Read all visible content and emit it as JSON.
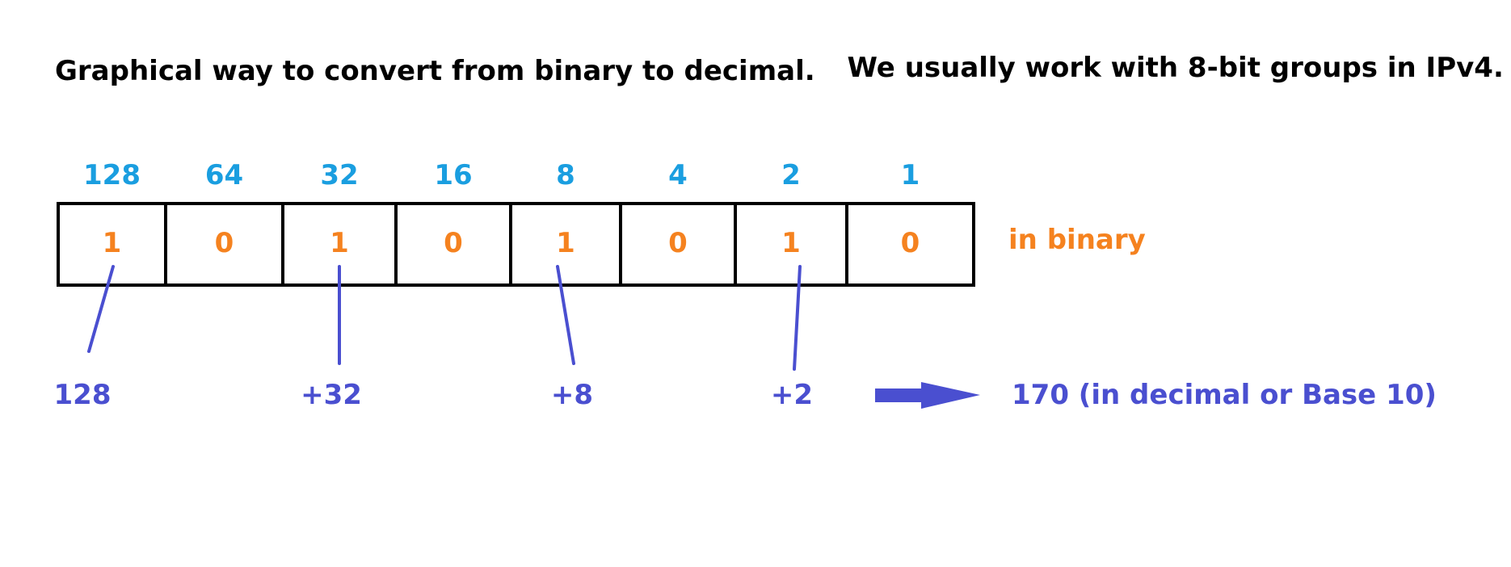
{
  "heading": {
    "part1": "Graphical way to convert from binary to decimal.",
    "part2": "We usually work with 8-bit groups in IPv4."
  },
  "weights": [
    "128",
    "64",
    "32",
    "16",
    "8",
    "4",
    "2",
    "1"
  ],
  "bits": [
    "1",
    "0",
    "1",
    "0",
    "1",
    "0",
    "1",
    "0"
  ],
  "binary_label": "in binary",
  "terms": [
    {
      "bit_index": 0,
      "text": "128"
    },
    {
      "bit_index": 2,
      "text": "+32"
    },
    {
      "bit_index": 4,
      "text": "+8"
    },
    {
      "bit_index": 6,
      "text": "+2"
    }
  ],
  "result": "170 (in decimal or Base 10)",
  "colors": {
    "weight": "#1a9ee0",
    "bit": "#f5821f",
    "term": "#4a4fd0",
    "box": "#000000",
    "arrow": "#4a4fd0"
  }
}
